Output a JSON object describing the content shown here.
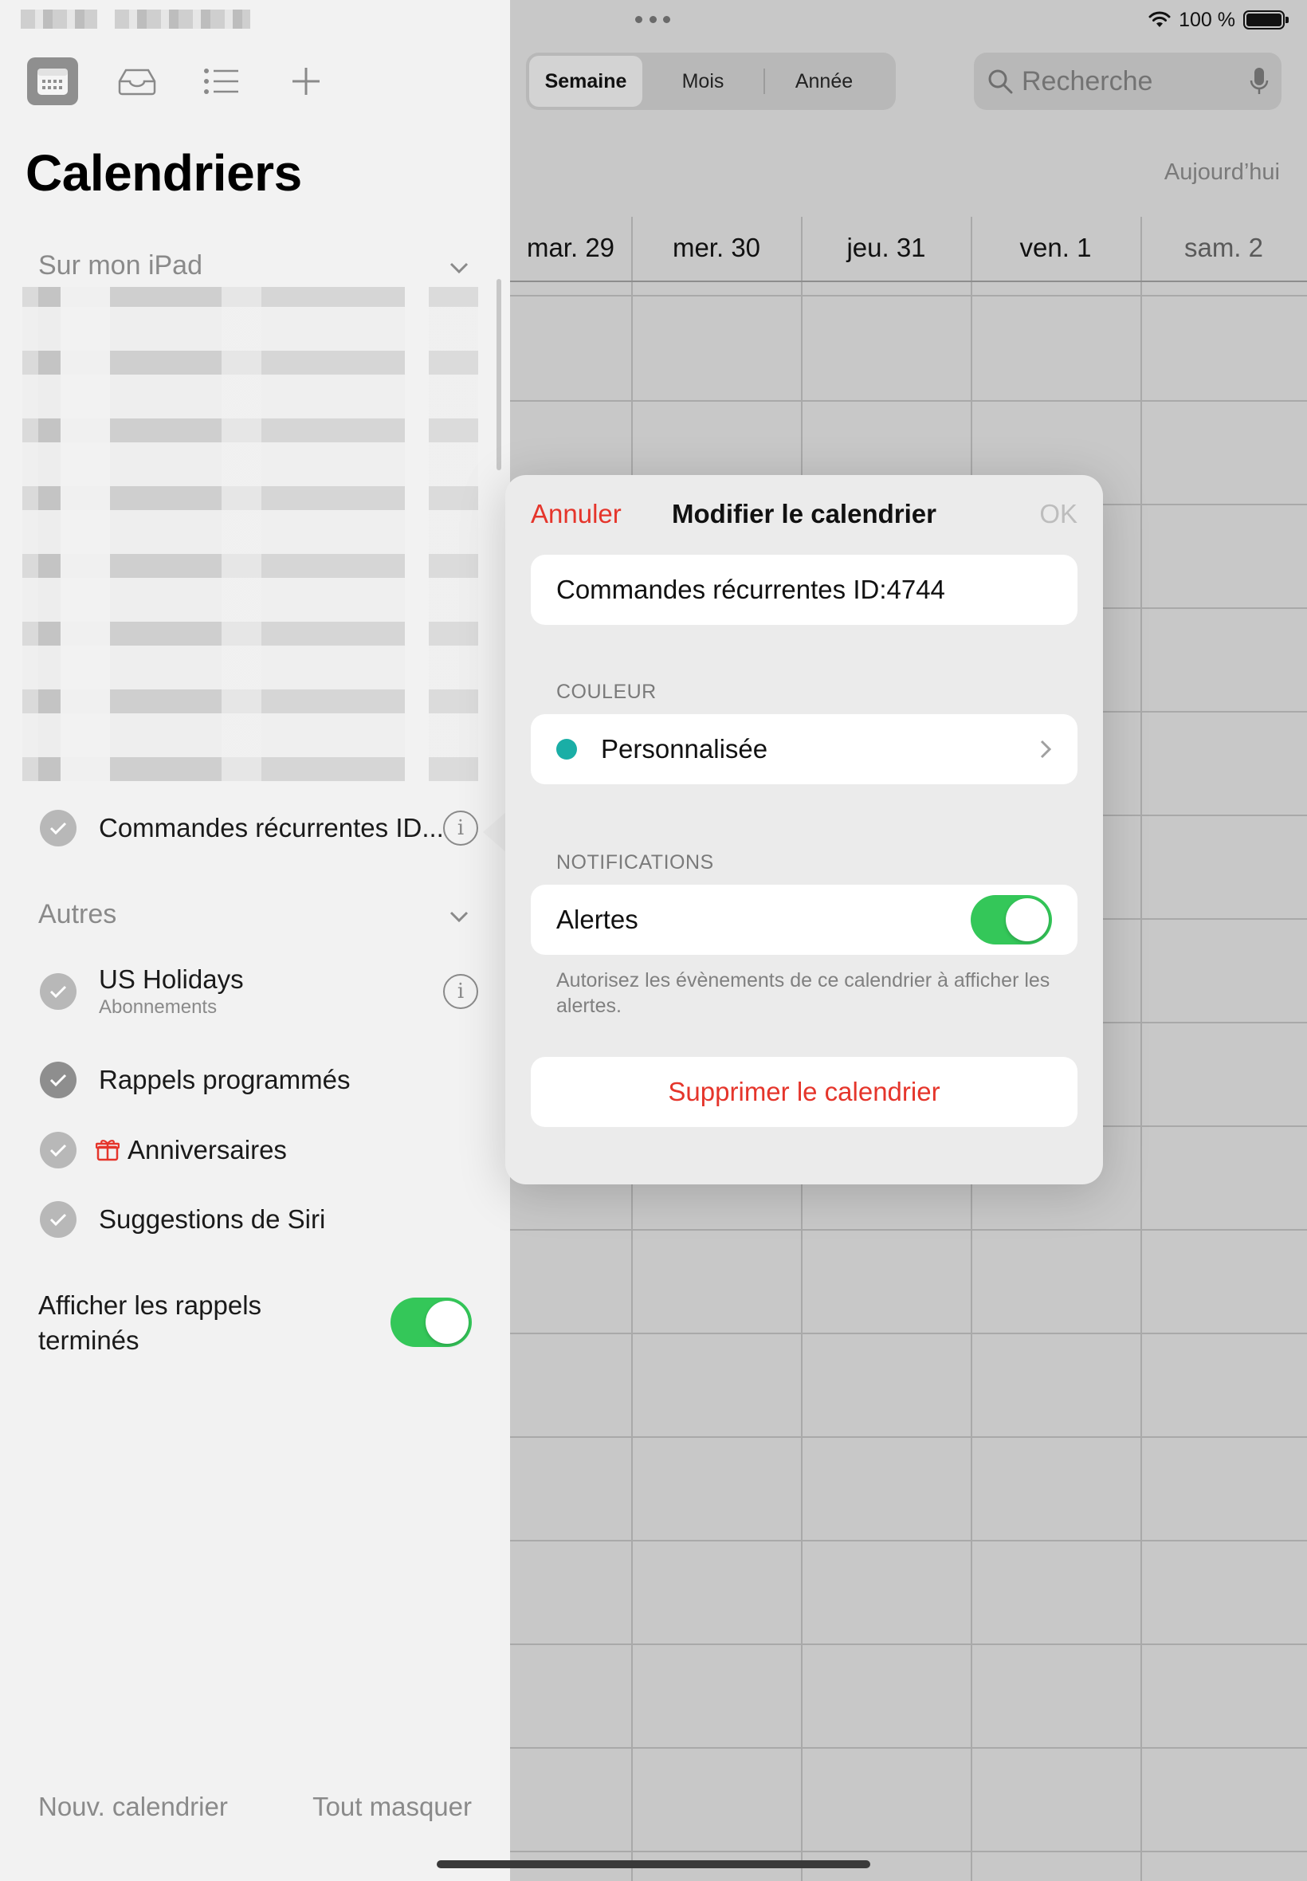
{
  "status": {
    "battery": "100 %"
  },
  "view_switcher": {
    "week": "Semaine",
    "month": "Mois",
    "year": "Année"
  },
  "search": {
    "placeholder": "Recherche"
  },
  "today_label": "Aujourd’hui",
  "days": [
    "mar. 29",
    "mer. 30",
    "jeu. 31",
    "ven. 1",
    "sam. 2"
  ],
  "sidebar": {
    "title": "Calendriers",
    "section_ipad": "Sur mon iPad",
    "selected_calendar": "Commandes récurrentes ID...",
    "section_others": "Autres",
    "others": [
      {
        "label": "US Holidays",
        "sub": "Abonnements"
      },
      {
        "label": "Rappels programmés"
      },
      {
        "label": "Anniversaires"
      },
      {
        "label": "Suggestions de Siri"
      }
    ],
    "show_done_label": "Afficher les rappels terminés",
    "new_calendar": "Nouv. calendrier",
    "hide_all": "Tout masquer"
  },
  "popover": {
    "cancel": "Annuler",
    "title": "Modifier le calendrier",
    "ok": "OK",
    "name_value": "Commandes récurrentes ID:4744",
    "color_section": "COULEUR",
    "color_value": "Personnalisée",
    "color_hex": "#1aaea6",
    "notifications_section": "NOTIFICATIONS",
    "alerts_label": "Alertes",
    "alerts_note": "Autorisez les évènements de ce calendrier à afficher les alertes.",
    "delete": "Supprimer le calendrier"
  },
  "colors": {
    "accent_red": "#e5352b",
    "toggle_green": "#34c759"
  }
}
